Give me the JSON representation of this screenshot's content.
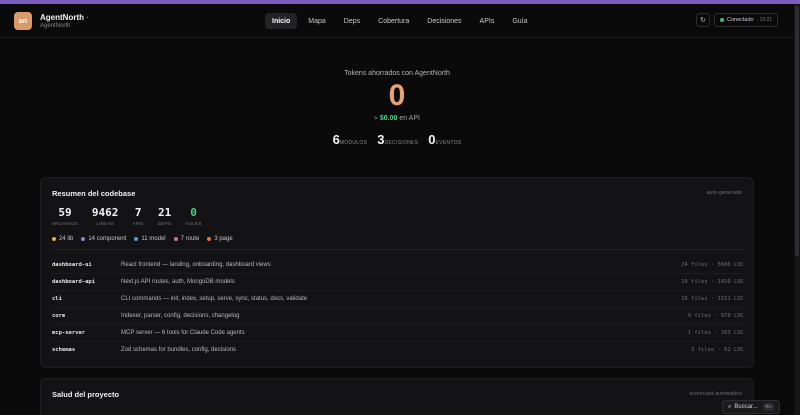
{
  "brand": {
    "logo_text": "an",
    "title": "AgentNorth",
    "title_suffix": "·",
    "subtitle": "AgentNorth"
  },
  "nav": {
    "items": [
      {
        "label": "Inicio",
        "active": true
      },
      {
        "label": "Mapa"
      },
      {
        "label": "Deps"
      },
      {
        "label": "Cobertura"
      },
      {
        "label": "Decisiones"
      },
      {
        "label": "APIs"
      },
      {
        "label": "Guía"
      }
    ]
  },
  "header": {
    "refresh_glyph": "↻",
    "status": {
      "label": "Conectado",
      "time": "· 10:21",
      "color": "#3fbf6f"
    }
  },
  "hero": {
    "label": "Tokens ahorrados con AgentNorth",
    "tokens": "0",
    "cost_prefix": "≈",
    "cost_value": "$0.00",
    "cost_suffix": "en API",
    "stats": [
      {
        "value": "6",
        "label": "MÓDULOS"
      },
      {
        "value": "3",
        "label": "DECISIONES"
      },
      {
        "value": "0",
        "label": "EVENTOS"
      }
    ]
  },
  "summary": {
    "title": "Resumen del codebase",
    "tag": "auto-generado",
    "metrics": [
      {
        "value": "59",
        "label": "ARCHIVOS"
      },
      {
        "value": "9462",
        "label": "LÍNEAS"
      },
      {
        "value": "7",
        "label": "APIS"
      },
      {
        "value": "21",
        "label": "DEPS"
      },
      {
        "value": "0",
        "label": "VULNS",
        "highlight": true
      }
    ],
    "legend": [
      {
        "label": "24 lib",
        "color": "#e0b040"
      },
      {
        "label": "14 component",
        "color": "#9a7ae0"
      },
      {
        "label": "11 model",
        "color": "#5a9ae0"
      },
      {
        "label": "7 route",
        "color": "#e06a9a"
      },
      {
        "label": "3 page",
        "color": "#e07a40"
      }
    ],
    "modules": [
      {
        "name": "dashboard-ui",
        "desc": "React frontend — landing, onboarding, dashboard views",
        "meta": "24 files · 5606 LOC"
      },
      {
        "name": "dashboard-api",
        "desc": "Next.js API routes, auth, MongoDB models",
        "meta": "19 files · 1410 LOC"
      },
      {
        "name": "cli",
        "desc": "CLI commands — init, index, setup, serve, sync, status, docs, validate",
        "meta": "10 files · 1151 LOC"
      },
      {
        "name": "core",
        "desc": "Indexer, parser, config, decisions, changelog",
        "meta": "9 files · 970 LOC"
      },
      {
        "name": "mcp-server",
        "desc": "MCP server — 6 tools for Claude Code agents",
        "meta": "1 files · 263 LOC"
      },
      {
        "name": "schemas",
        "desc": "Zod schemas for bundles, config, decisions",
        "meta": "3 files · 62 LOC"
      }
    ]
  },
  "health": {
    "title": "Salud del proyecto",
    "tag": "scorecard automático"
  },
  "search": {
    "glyph": "⌕",
    "label": "Buscar...",
    "shortcut": "⌘K"
  }
}
